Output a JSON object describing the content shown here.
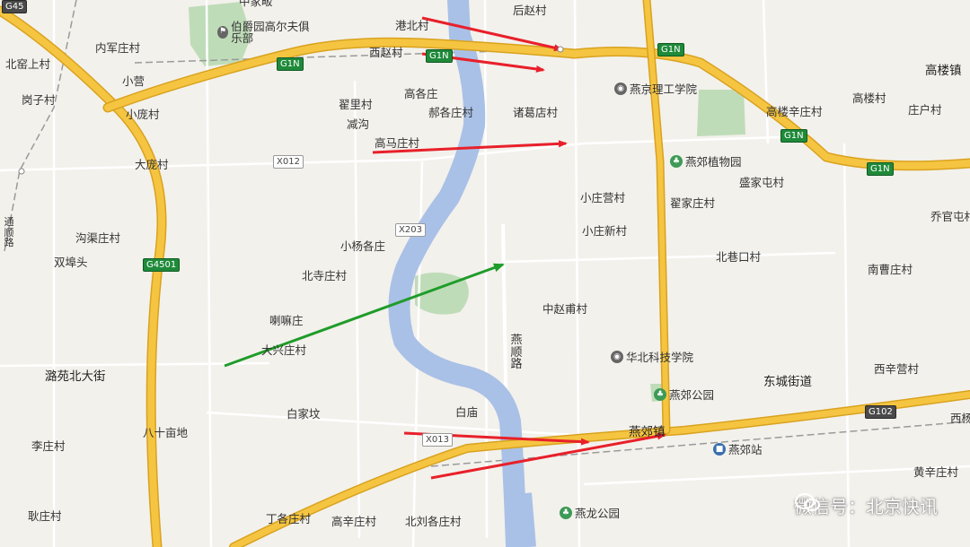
{
  "labels": {
    "zhong": "中家畈",
    "neijunzhuang": "内军庄村",
    "beiyaoshang": "北窑上村",
    "xiaoying": "小营",
    "gangzi": "岗子村",
    "xiaopang": "小庞村",
    "dapang": "大庞村",
    "goukeqzhuang": "沟渠庄村",
    "shuangfu": "双埠头",
    "xizhao": "西赵村",
    "gangbei": "港北村",
    "houzhao": "后赵村",
    "zhaili": "翟里村",
    "jiangou": "减沟",
    "gaogezhuang": "高各庄",
    "dugezhuang": "郝各庄村",
    "zhugedian": "诸葛店村",
    "gaomazhuang": "高马庄村",
    "xiaoyanggezhuang": "小杨各庄",
    "beisizhuang": "北寺庄村",
    "lama": "喇嘛庄",
    "daxingzhuang": "大兴庄村",
    "luyuan": "潞苑北大街",
    "bashimu": "八十亩地",
    "lizhuang": "李庄村",
    "baijia": "白家坟",
    "baimiao": "白庙",
    "yanshun_road": "燕顺路",
    "xiaozhuangying": "小庄营村",
    "xiaozhuangxin": "小庄新村",
    "zhaijiazhuang": "翟家庄村",
    "shengjiatun": "盛家屯村",
    "beixiangkou": "北巷口村",
    "zhongzhaofu": "中赵甫村",
    "nancaozhuang": "南曹庄村",
    "gaolouxinzhuang": "高楼辛庄村",
    "gaolou": "高楼村",
    "zhuanghu": "庄户村",
    "gaolouzhen": "高楼镇",
    "qiaoguan": "乔官屯村",
    "dongcheng": "东城街道",
    "xixinying": "西辛营村",
    "yanjiaozhen": "燕郊镇",
    "huangxinzhuang": "黄辛庄村",
    "xigang": "西杨",
    "dinggezhuang": "丁各庄村",
    "gaoxinzhuang": "高辛庄村",
    "beiliugezhuang": "北刘各庄村",
    "gengzhuang": "耿庄村",
    "tongshun_road": "通顺路"
  },
  "pois": {
    "golf": "伯爵园高尔夫俱乐部",
    "yanjing_inst": "燕京理工学院",
    "botanic": "燕郊植物园",
    "huabei_inst": "华北科技学院",
    "yanjiao_park": "燕郊公园",
    "yanjiao_station": "燕郊站",
    "yanlong_park": "燕龙公园"
  },
  "shields": {
    "g45": "G45",
    "g1n_a": "G1N",
    "g1n_b": "G1N",
    "g1n_c": "G1N",
    "g1n_d": "G1N",
    "g1n_e": "G1N",
    "x012": "X012",
    "x203": "X203",
    "g4501": "G4501",
    "g102": "G102",
    "x013": "X013"
  },
  "watermark": "微信号：北京快讯",
  "colors": {
    "background": "#f3f1ec",
    "river": "#a9c1e6",
    "park": "#bfdcb8",
    "expressway": "#f5c542",
    "expressway_edge": "#d9a21e",
    "red_arrow": "#e8202a",
    "green_arrow": "#1f9c2a",
    "road": "#ffffff"
  }
}
